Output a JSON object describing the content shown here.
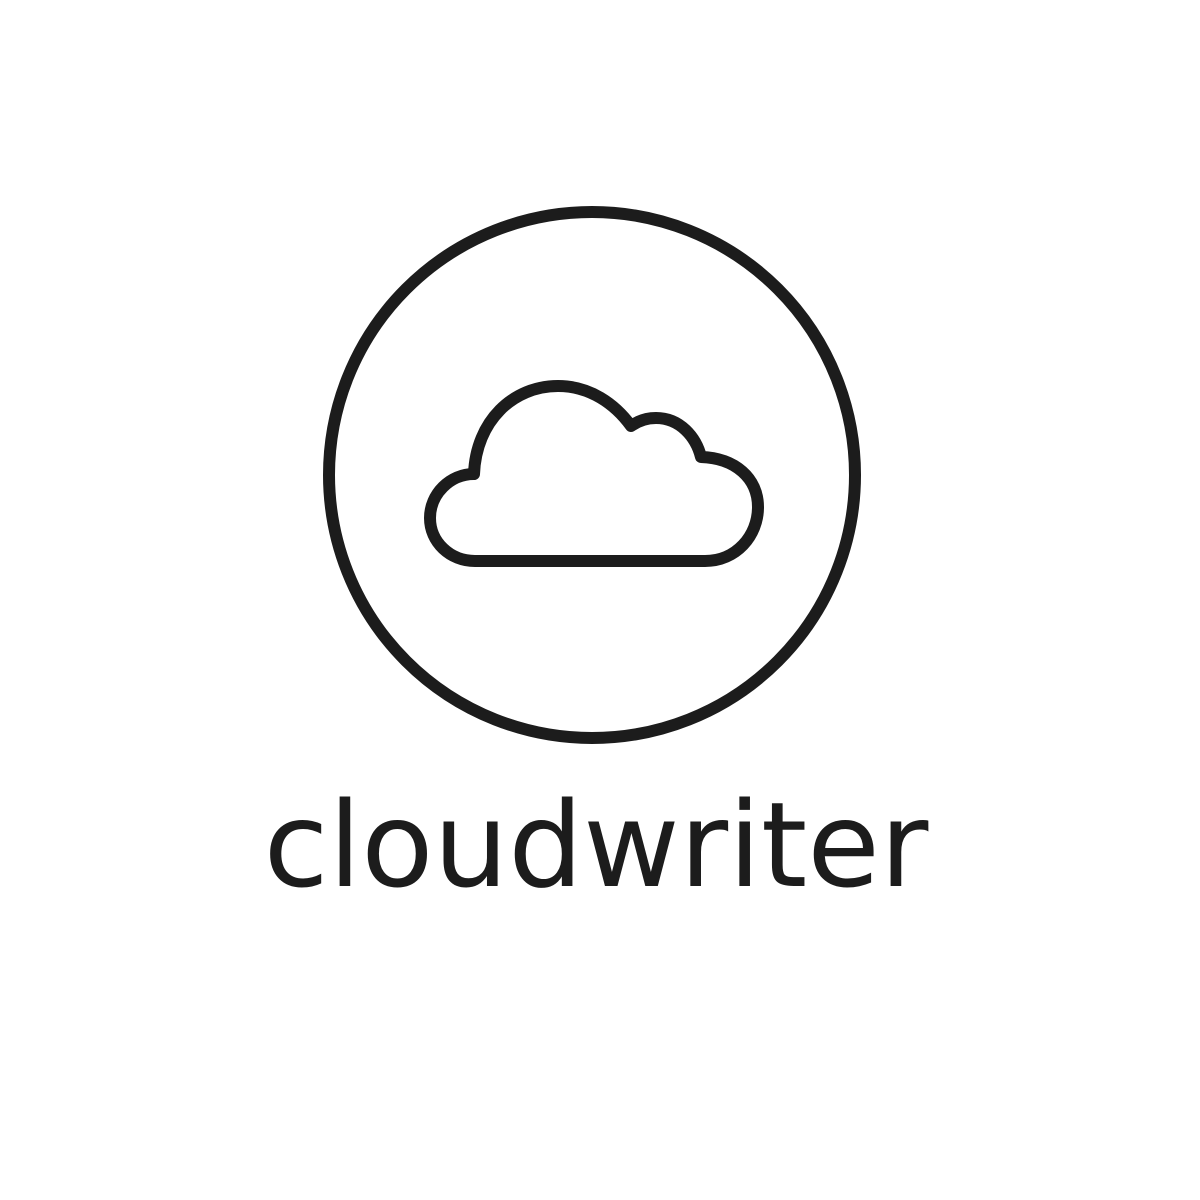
{
  "logo": {
    "wordmark": "cloudwriter",
    "emblem_icon": "cloud-icon",
    "colors": {
      "stroke": "#1c1c1c",
      "background": "#ffffff"
    }
  }
}
